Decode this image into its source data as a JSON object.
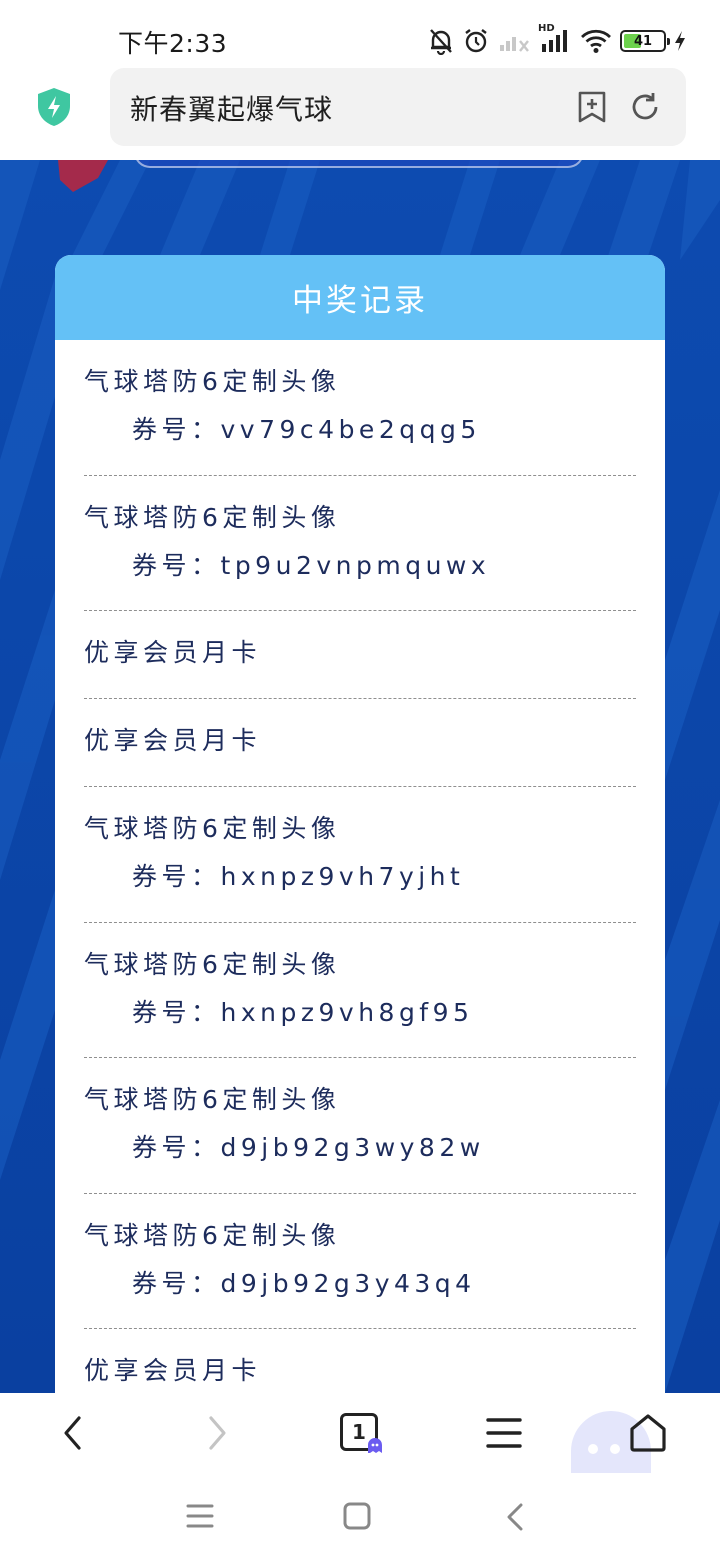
{
  "status_bar": {
    "time": "下午2:33",
    "battery_level": "41",
    "network_label": "HD",
    "icons": [
      "mute-bell-icon",
      "alarm-icon",
      "signal-sim2-icon",
      "signal-hd-icon",
      "wifi-icon",
      "battery-icon",
      "charging-bolt-icon"
    ]
  },
  "toolbar": {
    "url_text": "新春翼起爆气球",
    "icons": [
      "shield-icon",
      "bookmark-add-icon",
      "reload-icon"
    ],
    "accent_color": "#3fc7a1"
  },
  "record_panel": {
    "title": "中奖记录",
    "coupon_label": "券号：",
    "items": [
      {
        "name": "气球塔防6定制头像",
        "code": "vv79c4be2qqg5"
      },
      {
        "name": "气球塔防6定制头像",
        "code": "tp9u2vnpmquwx"
      },
      {
        "name": "优享会员月卡",
        "code": ""
      },
      {
        "name": "优享会员月卡",
        "code": ""
      },
      {
        "name": "气球塔防6定制头像",
        "code": "hxnpz9vh7yjht"
      },
      {
        "name": "气球塔防6定制头像",
        "code": "hxnpz9vh8gf95"
      },
      {
        "name": "气球塔防6定制头像",
        "code": "d9jb92g3wy82w"
      },
      {
        "name": "气球塔防6定制头像",
        "code": "d9jb92g3y43q4"
      },
      {
        "name": "优享会员月卡",
        "code": ""
      }
    ],
    "header_color": "#64c1f6",
    "background_color": "#0a45a8"
  },
  "browser_nav": {
    "tab_count": "1",
    "icons": [
      "back-icon",
      "forward-icon",
      "tabs-icon",
      "menu-icon",
      "home-icon"
    ]
  },
  "system_nav": {
    "icons": [
      "recents-icon",
      "home-square-icon",
      "system-back-icon"
    ]
  }
}
